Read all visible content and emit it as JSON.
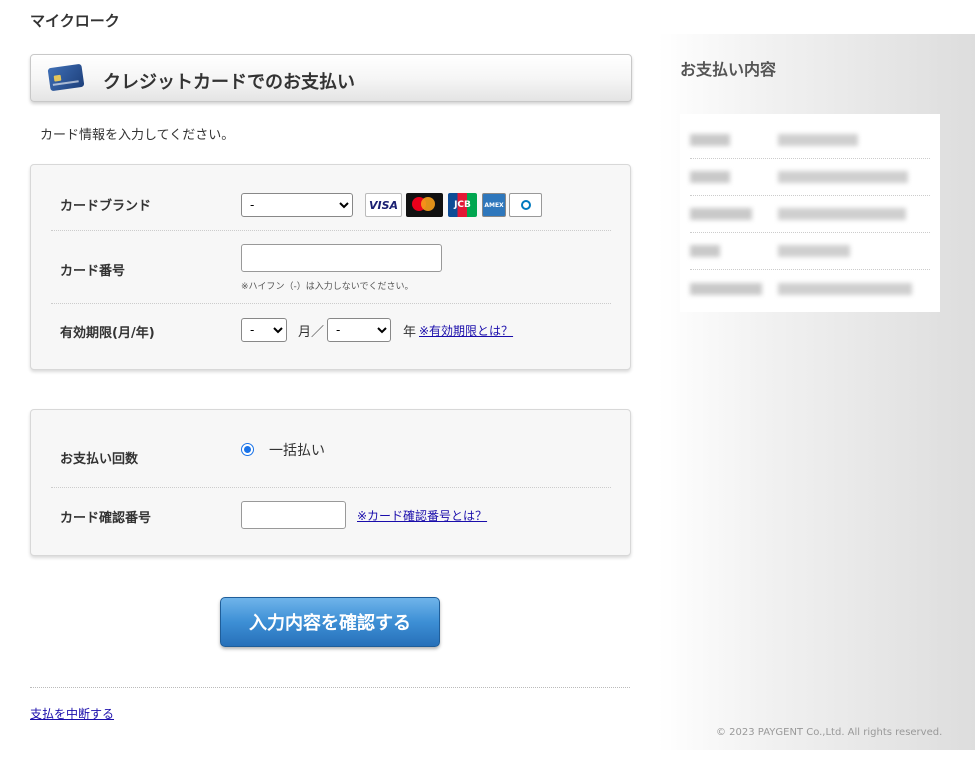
{
  "site": {
    "title": "マイクローク"
  },
  "header": {
    "title": "クレジットカードでのお支払い"
  },
  "instruction": "カード情報を入力してください。",
  "card_form": {
    "brand": {
      "label": "カードブランド",
      "selected": "-",
      "brands": [
        "VISA",
        "mastercard",
        "JCB",
        "AMERICAN EXPRESS",
        "Diners Club INTERNATIONAL"
      ]
    },
    "number": {
      "label": "カード番号",
      "note": "※ハイフン（-）は入力しないでください。"
    },
    "expiry": {
      "label": "有効期限(月/年)",
      "month_selected": "-",
      "month_suffix": "月／",
      "year_selected": "-",
      "year_suffix": "年",
      "help_link": "※有効期限とは？"
    }
  },
  "payment_form": {
    "installments": {
      "label": "お支払い回数",
      "option": "一括払い"
    },
    "cvv": {
      "label": "カード確認番号",
      "help_link": "※カード確認番号とは？"
    }
  },
  "submit_button": "入力内容を確認する",
  "cancel_link": "支払を中断する",
  "summary": {
    "title": "お支払い内容"
  },
  "footer": {
    "copyright": "© 2023 PAYGENT Co.,Ltd. All rights reserved."
  }
}
